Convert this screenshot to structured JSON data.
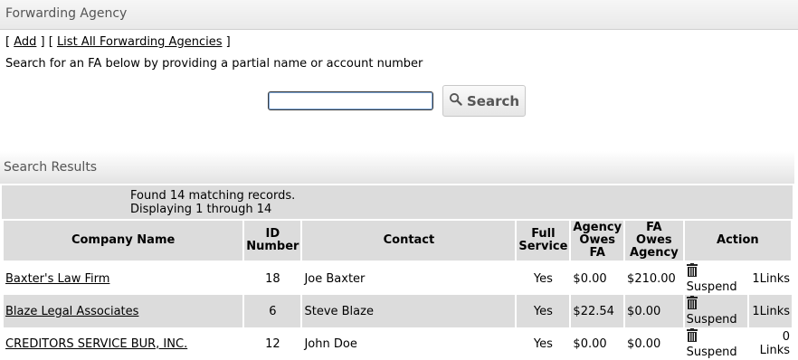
{
  "header": {
    "title": "Forwarding Agency"
  },
  "links": {
    "add": "Add",
    "list_all": "List All Forwarding Agencies"
  },
  "instruction": "Search for an FA below by providing a partial name or account number",
  "search": {
    "value": "",
    "button_label": "Search"
  },
  "results": {
    "title": "Search Results",
    "found_text": "Found 14 matching records.",
    "display_text": "Displaying 1 through 14",
    "columns": [
      "Company Name",
      "ID Number",
      "Contact",
      "Full Service",
      "Agency Owes FA",
      "FA Owes Agency",
      "Action"
    ],
    "rows": [
      {
        "company": "Baxter's Law Firm",
        "id": "18",
        "contact": "Joe Baxter",
        "full_service": "Yes",
        "agency_owes": "$0.00",
        "fa_owes": "$210.00",
        "action": "Suspend",
        "links": "1Links"
      },
      {
        "company": "Blaze Legal Associates",
        "id": "6",
        "contact": "Steve Blaze",
        "full_service": "Yes",
        "agency_owes": "$22.54",
        "fa_owes": "$0.00",
        "action": "Suspend",
        "links": "1Links"
      },
      {
        "company": "CREDITORS SERVICE BUR, INC.",
        "id": "12",
        "contact": "John Doe",
        "full_service": "Yes",
        "agency_owes": "$0.00",
        "fa_owes": "$0.00",
        "action": "Suspend",
        "links": "0 Links"
      }
    ]
  }
}
